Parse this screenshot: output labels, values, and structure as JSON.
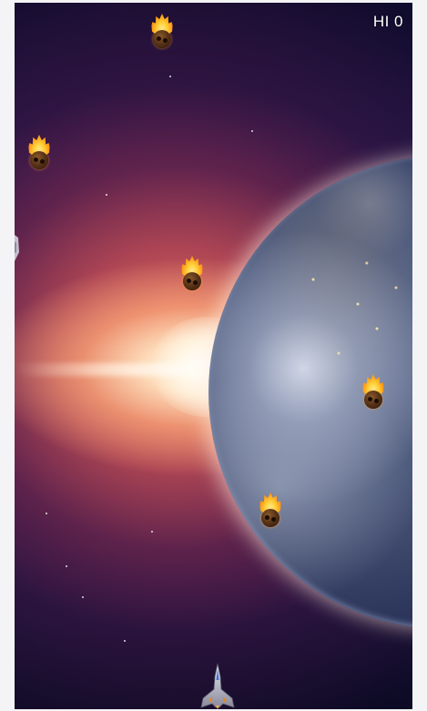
{
  "hud": {
    "score_label": "HI 0"
  },
  "sprites": {
    "player": "spaceship-icon",
    "enemy": "flaming-meteor-icon",
    "meteor_count": 6
  },
  "background": {
    "scene": "earth-and-sun-flare",
    "colors": {
      "space": "#1d1340",
      "flare": "#f5a078",
      "planet": "#4a5678"
    }
  }
}
